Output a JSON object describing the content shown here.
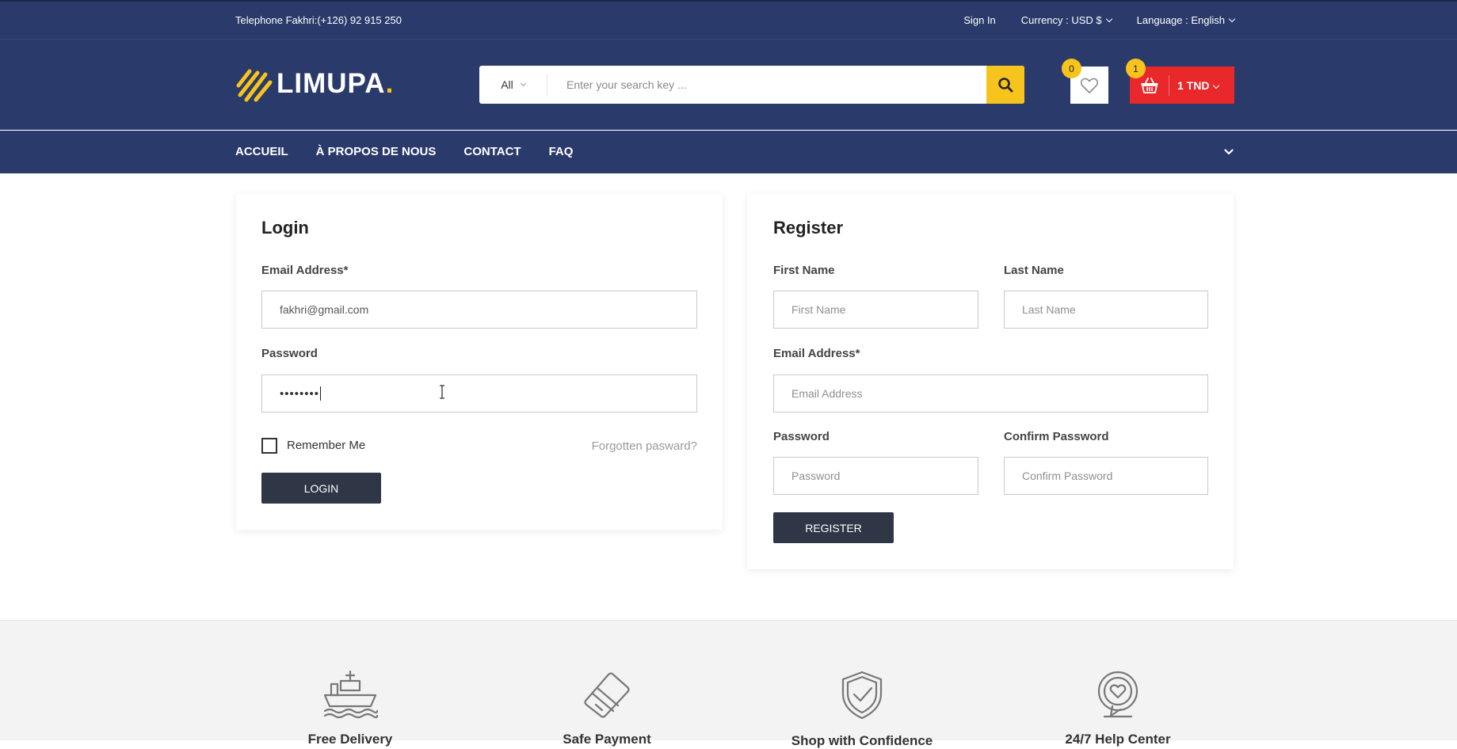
{
  "topbar": {
    "phone": "Telephone Fakhri:(+126) 92 915 250",
    "sign_in": "Sign In",
    "currency_label": "Currency : ",
    "currency_value": "USD $",
    "language_label": "Language : ",
    "language_value": "English"
  },
  "header": {
    "logo_text": "LIMUPA",
    "logo_dot": ".",
    "search": {
      "category": "All",
      "placeholder": "Enter your search key ..."
    },
    "wishlist_count": "0",
    "cart_count": "1",
    "cart_total": "1 TND"
  },
  "nav": {
    "items": [
      "ACCUEIL",
      "À PROPOS DE NOUS",
      "CONTACT",
      "FAQ"
    ]
  },
  "login": {
    "title": "Login",
    "email_label": "Email Address*",
    "email_value": "fakhri@gmail.com",
    "password_label": "Password",
    "password_value": "••••••••",
    "remember_label": "Remember Me",
    "forgot_link": "Forgotten pasward?",
    "submit_label": "LOGIN"
  },
  "register": {
    "title": "Register",
    "first_name_label": "First Name",
    "first_name_placeholder": "First Name",
    "last_name_label": "Last Name",
    "last_name_placeholder": "Last Name",
    "email_label": "Email Address*",
    "email_placeholder": "Email Address",
    "password_label": "Password",
    "password_placeholder": "Password",
    "confirm_label": "Confirm Password",
    "confirm_placeholder": "Confirm Password",
    "submit_label": "REGISTER"
  },
  "features": [
    {
      "title": "Free Delivery",
      "icon": "ship-icon"
    },
    {
      "title": "Safe Payment",
      "icon": "credit-card-icon"
    },
    {
      "title": "Shop with Confidence",
      "icon": "shield-check-icon"
    },
    {
      "title": "24/7 Help Center",
      "icon": "chat-heart-icon"
    }
  ],
  "colors": {
    "primary_navy": "#2a3a6a",
    "accent_yellow": "#f7c41d",
    "cart_red": "#e8282a",
    "button_dark": "#2f3645"
  }
}
